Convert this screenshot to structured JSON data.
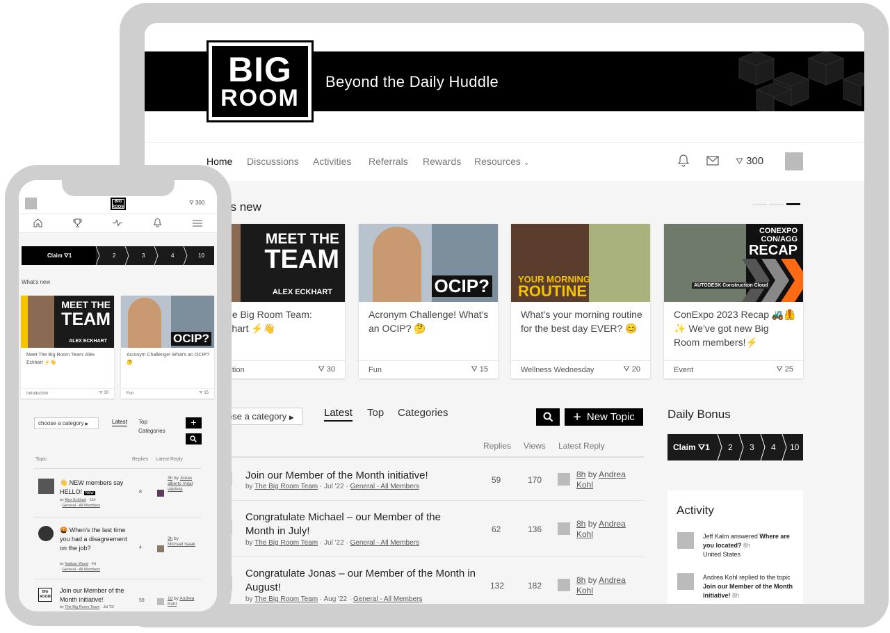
{
  "brand": {
    "logo_line1": "BIG",
    "logo_line2": "ROOM",
    "tagline": "Beyond the Daily Huddle"
  },
  "nav": {
    "items": [
      "Home",
      "Discussions",
      "Activities",
      "Referrals",
      "Rewards",
      "Resources"
    ],
    "points": "300"
  },
  "whats_new": {
    "title": "’s new",
    "cards": [
      {
        "title": "t The Big Room Team: Eckhart ⚡👋",
        "category": "oduction",
        "points": "30",
        "img_line1": "MEET THE",
        "img_line2": "TEAM",
        "img_caption": "ALEX ECKHART"
      },
      {
        "title": "Acronym Challenge! What's an OCIP? 🤔",
        "category": "Fun",
        "points": "15",
        "img_text": "OCIP?"
      },
      {
        "title": "What's your morning routine for the best day EVER? 😊",
        "category": "Wellness Wednesday",
        "points": "20",
        "img_line1": "YOUR MORNING",
        "img_line2": "ROUTINE"
      },
      {
        "title": "ConExpo 2023 Recap 🚜🦺 ✨ We've got new Big Room members!⚡",
        "category": "Event",
        "points": "25",
        "img_line1": "CONEXPO",
        "img_line2": "CON/AGG",
        "img_line3": "RECAP",
        "img_caption": "AUTODESK Construction Cloud"
      }
    ]
  },
  "topics": {
    "category_select": "ose a category",
    "tabs": [
      "Latest",
      "Top",
      "Categories"
    ],
    "new_topic": "New Topic",
    "headers": {
      "replies": "Replies",
      "views": "Views",
      "latest": "Latest Reply"
    },
    "rows": [
      {
        "title": "Join our Member of the Month initiative!",
        "by": "by",
        "author": "The Big Room Team",
        "date": "Jul '22",
        "category": "General - All Members",
        "replies": "59",
        "views": "170",
        "time": "8h",
        "lr_by": "by",
        "user": "Andrea Kohl"
      },
      {
        "title": "Congratulate Michael – our Member of the Month in July!",
        "by": "by",
        "author": "The Big Room Team",
        "date": "Jul '22",
        "category": "General - All Members",
        "replies": "62",
        "views": "136",
        "time": "8h",
        "lr_by": "by",
        "user": "Andrea Kohl"
      },
      {
        "title": "Congratulate Jonas – our Member of the Month in August!",
        "by": "by",
        "author": "The Big Room Team",
        "date": "Aug '22",
        "category": "General - All Members",
        "replies": "132",
        "views": "182",
        "time": "8h",
        "lr_by": "by",
        "user": "Andrea Kohl"
      }
    ]
  },
  "daily_bonus": {
    "title": "Daily Bonus",
    "claim": "Claim",
    "claim_num": "1",
    "steps": [
      "2",
      "3",
      "4",
      "10"
    ]
  },
  "activity": {
    "title": "Activity",
    "items": [
      {
        "who": "Jeff Kalm",
        "action": "answered",
        "target": "Where are you located?",
        "time": "8h",
        "extra": "United States"
      },
      {
        "who": "Andrea Kohl",
        "action": "replied to the topic",
        "target": "Join our Member of the Month initiative!",
        "time": "8h"
      }
    ]
  },
  "phone": {
    "logo": "BIG ROOM",
    "points": "300",
    "claim": "Claim",
    "claim_num": "1",
    "steps": [
      "2",
      "3",
      "4",
      "10"
    ],
    "whats_new": "What's new",
    "cards": [
      {
        "title": "Meet The Big Room Team: Alex Eckhart ⚡👋",
        "category": "Introduction",
        "points": "30",
        "img_line1": "MEET THE",
        "img_line2": "TEAM",
        "img_caption": "ALEX ECKHART"
      },
      {
        "title": "Acronym Challenge! What's an OCIP? 🤔",
        "category": "Fun",
        "points": "15",
        "img_text": "OCIP?"
      }
    ],
    "category_select": "choose a category",
    "tabs": [
      "Latest",
      "Top",
      "Categories"
    ],
    "headers": {
      "topic": "Topic",
      "replies": "Replies",
      "latest": "Latest Reply"
    },
    "rows": [
      {
        "title": "👋 NEW members say HELLO!",
        "badge": "New",
        "author": "Alex Eckhart",
        "age": "11h",
        "category": "General - All Members",
        "replies": "8",
        "time": "3h",
        "by": "by",
        "user": "Jonas alberto Vidal valdivia"
      },
      {
        "title": "🤬 When's the last time you had a disagreement on the job?",
        "author": "Nathan Wood",
        "age": "4d",
        "category": "General - All Members",
        "replies": "4",
        "time": "3h",
        "by": "by",
        "user": "Michael Isaak"
      },
      {
        "title": "Join our Member of the Month initiative!",
        "author": "The Big Room Team",
        "age": "Jul '22",
        "replies": "59",
        "time": "1d",
        "by": "by",
        "user": "Andrea Kohl"
      }
    ]
  }
}
